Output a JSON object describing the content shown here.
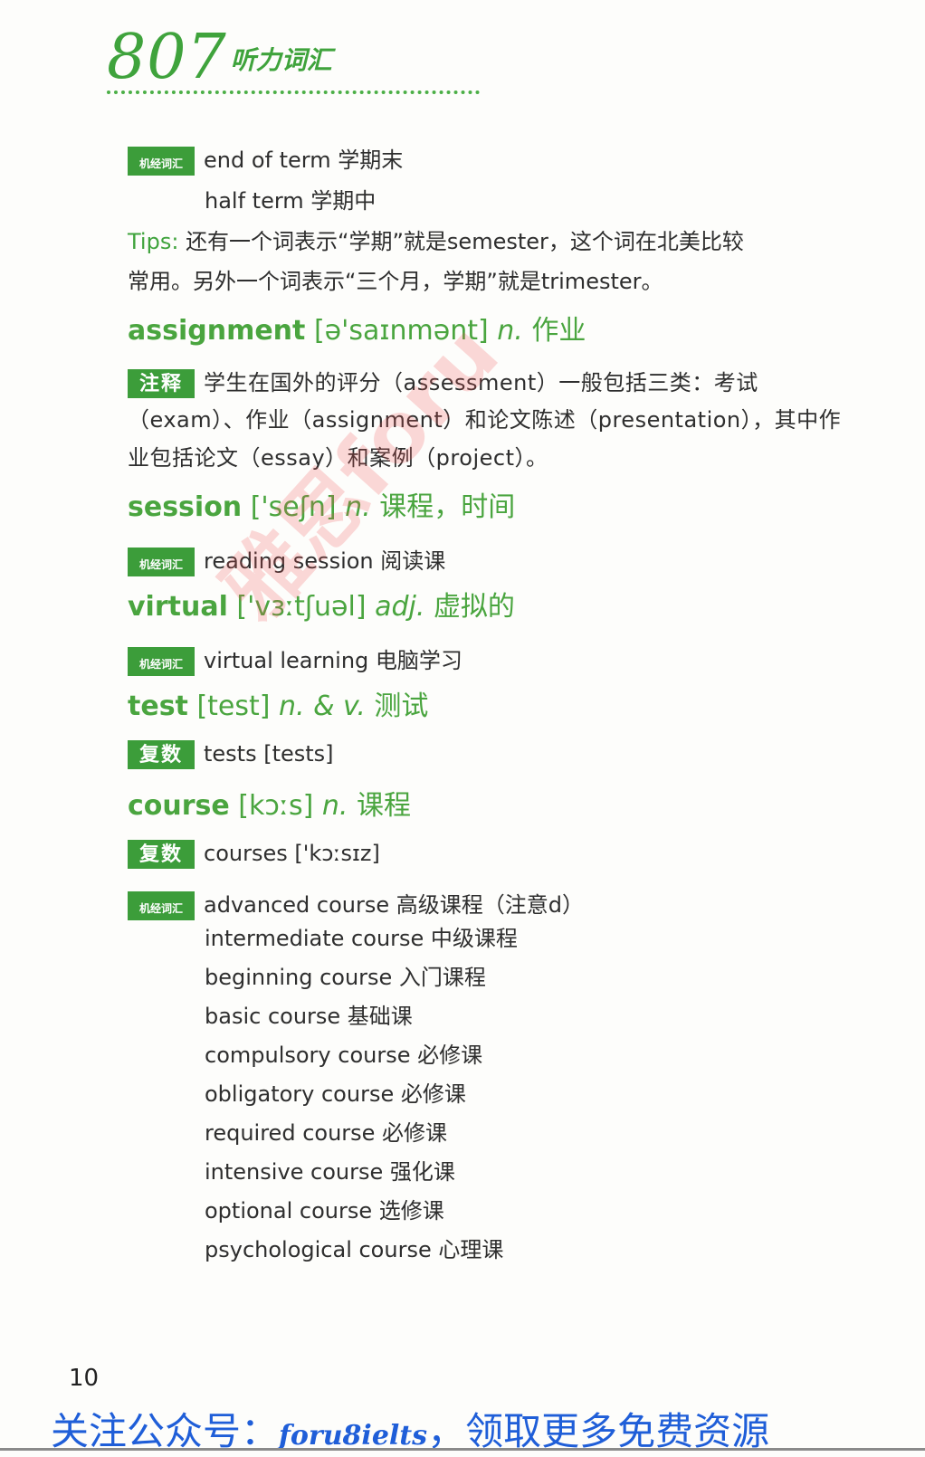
{
  "header": {
    "number": "807",
    "subtitle": "听力词汇"
  },
  "entries": {
    "term_tag": "机经词汇",
    "term_line1": "end of term 学期末",
    "term_line2": "half term 学期中",
    "tips_label": "Tips:",
    "tips_line1": "还有一个词表示“学期”就是semester，这个词在北美比较",
    "tips_line2": "常用。另外一个词表示“三个月，学期”就是trimester。",
    "assignment": {
      "word": "assignment",
      "phon": "[ə'saɪnmənt]",
      "pos": "n.",
      "meaning": "作业"
    },
    "note_tag": "注释",
    "note_line1": "学生在国外的评分（assessment）一般包括三类：考试",
    "note_line2": "（exam）、作业（assignment）和论文陈述（presentation），其中作",
    "note_line3": "业包括论文（essay）和案例（project）。",
    "session": {
      "word": "session",
      "phon": "['seʃn]",
      "pos": "n.",
      "meaning": "课程，时间"
    },
    "session_tag": "机经词汇",
    "session_line": "reading session 阅读课",
    "virtual": {
      "word": "virtual",
      "phon": "['vɜːtʃuəl]",
      "pos": "adj.",
      "meaning": "虚拟的"
    },
    "virtual_tag": "机经词汇",
    "virtual_line": "virtual learning 电脑学习",
    "test": {
      "word": "test",
      "phon": "[test]",
      "pos": "n. & v.",
      "meaning": "测试"
    },
    "test_tag": "复数",
    "test_line": "tests [tests]",
    "course": {
      "word": "course",
      "phon": "[kɔːs]",
      "pos": "n.",
      "meaning": "课程"
    },
    "course_tag": "复数",
    "course_line": "courses ['kɔːsɪz]",
    "course_list_tag": "机经词汇",
    "course_list": [
      "advanced course 高级课程（注意d）",
      "intermediate course 中级课程",
      "beginning course 入门课程",
      "basic course 基础课",
      "compulsory course 必修课",
      "obligatory course 必修课",
      "required course 必修课",
      "intensive course 强化课",
      "optional course 选修课",
      "psychological course 心理课"
    ]
  },
  "page_number": "10",
  "footer": {
    "prefix": "关注公众号：",
    "brand": "foru8ielts",
    "suffix": "，领取更多免费资源"
  },
  "watermark": "雅思foru"
}
